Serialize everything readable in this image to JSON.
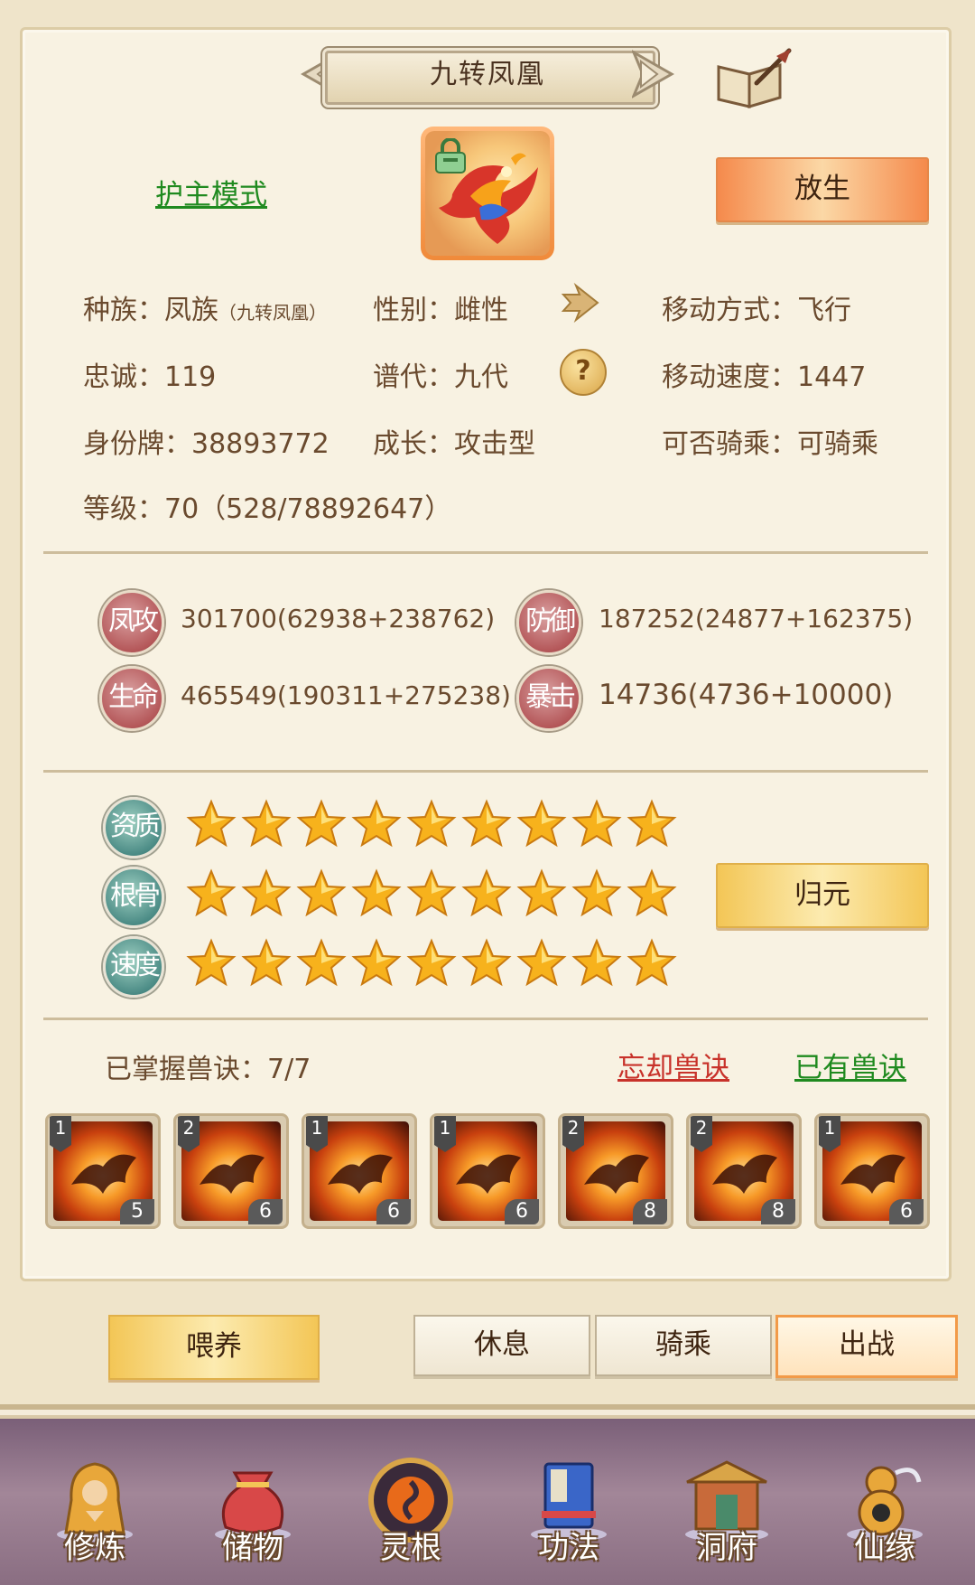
{
  "header": {
    "title": "九转凤凰"
  },
  "pet": {
    "mode_link": "护主模式",
    "release_button": "放生"
  },
  "info": {
    "race_label": "种族：凤族",
    "race_sub": "（九转凤凰）",
    "gender": "性别：雌性",
    "move_mode": "移动方式：飞行",
    "loyalty": "忠诚：119",
    "generation": "谱代：九代",
    "move_speed": "移动速度：1447",
    "id_tag": "身份牌：38893772",
    "growth": "成长：攻击型",
    "rideable": "可否骑乘：可骑乘",
    "level": "等级：70（528/78892647）"
  },
  "stats": [
    {
      "label": "凤攻",
      "value": "301700(62938+238762)"
    },
    {
      "label": "防御",
      "value": "187252(24877+162375)"
    },
    {
      "label": "生命",
      "value": "465549(190311+275238)"
    },
    {
      "label": "暴击",
      "value": "14736(4736+10000)"
    }
  ],
  "qualities": [
    {
      "label": "资质",
      "stars": 9
    },
    {
      "label": "根骨",
      "stars": 9
    },
    {
      "label": "速度",
      "stars": 9
    }
  ],
  "reset_button": "归元",
  "skills": {
    "mastered": "已掌握兽诀：7/7",
    "forget_link": "忘却兽诀",
    "owned_link": "已有兽诀",
    "items": [
      {
        "tier": "1",
        "level": "5"
      },
      {
        "tier": "2",
        "level": "6"
      },
      {
        "tier": "1",
        "level": "6"
      },
      {
        "tier": "1",
        "level": "6"
      },
      {
        "tier": "2",
        "level": "8"
      },
      {
        "tier": "2",
        "level": "8"
      },
      {
        "tier": "1",
        "level": "6"
      }
    ]
  },
  "actions": {
    "feed": "喂养",
    "rest": "休息",
    "ride": "骑乘",
    "battle": "出战"
  },
  "nav": [
    {
      "label": "修炼",
      "icon": "meditation-icon"
    },
    {
      "label": "储物",
      "icon": "bag-icon"
    },
    {
      "label": "灵根",
      "icon": "spirit-root-icon"
    },
    {
      "label": "功法",
      "icon": "book-icon"
    },
    {
      "label": "洞府",
      "icon": "cave-house-icon"
    },
    {
      "label": "仙缘",
      "icon": "gourd-icon"
    }
  ]
}
